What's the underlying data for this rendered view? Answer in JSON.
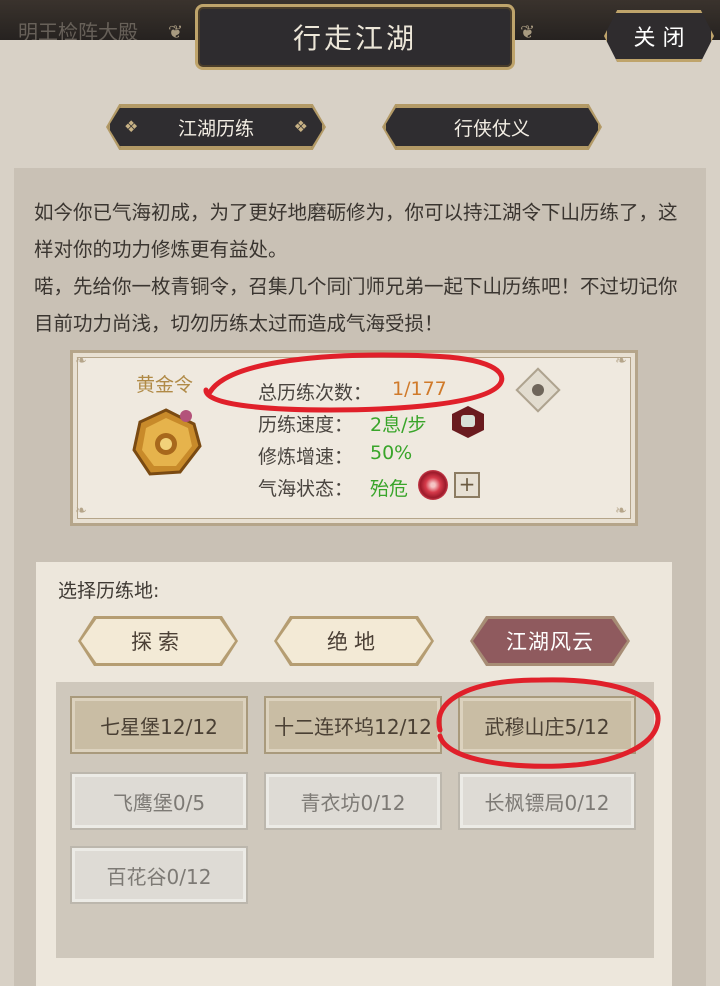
{
  "background": {
    "faded_text": "明王检阵大殿"
  },
  "header": {
    "title": "行走江湖",
    "close_label": "关 闭"
  },
  "tabs": [
    {
      "label": "江湖历练"
    },
    {
      "label": "行侠仗义"
    }
  ],
  "description": {
    "paragraph1": "如今你已气海初成，为了更好地磨砺修为，你可以持江湖令下山历练了，这样对你的功力修炼更有益处。",
    "paragraph2": "喏，先给你一枚青铜令，召集几个同门师兄弟一起下山历练吧！不过切记你目前功力尚浅，切勿历练太过而造成气海受损！"
  },
  "token_card": {
    "token_name": "黄金令",
    "stats": [
      {
        "label": "总历练次数：",
        "value": "1/177",
        "color": "#d07a2a"
      },
      {
        "label": "历练速度：",
        "value": "2息/步",
        "color": "#39a52a"
      },
      {
        "label": "修炼增速：",
        "value": "50%",
        "color": "#39a52a"
      },
      {
        "label": "气海状态：",
        "value": "殆危",
        "color": "#39a52a"
      }
    ],
    "plus_label": "+"
  },
  "select": {
    "label": "选择历练地:",
    "categories": [
      {
        "label": "探索"
      },
      {
        "label": "绝地"
      },
      {
        "label": "江湖风云"
      }
    ],
    "locations": [
      {
        "label": "七星堡12/12"
      },
      {
        "label": "十二连环坞12/12"
      },
      {
        "label": "武穆山庄5/12"
      },
      {
        "label": "飞鹰堡0/5"
      },
      {
        "label": "青衣坊0/12"
      },
      {
        "label": "长枫镖局0/12"
      },
      {
        "label": "百花谷0/12"
      }
    ]
  },
  "colors": {
    "annotation_red": "#e0202a",
    "accent_gold": "#bfa46b",
    "selected_category": "#8f5a5e"
  }
}
